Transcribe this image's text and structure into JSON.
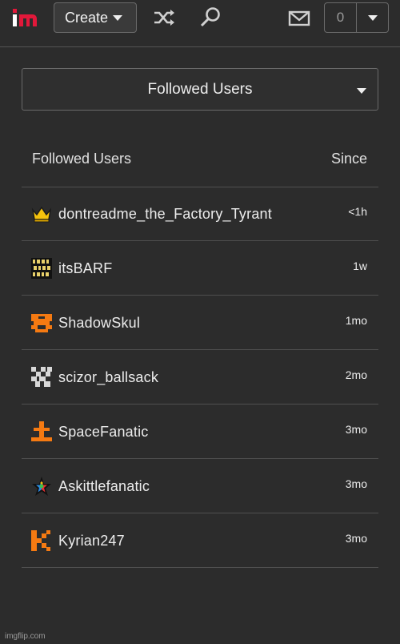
{
  "header": {
    "logo_text": "im",
    "create_label": "Create",
    "notification_count": "0"
  },
  "icons": {
    "logo": "imgflip-logo",
    "shuffle": "shuffle-icon",
    "search": "search-icon",
    "mail": "mail-icon"
  },
  "colors": {
    "background": "#2c2c2c",
    "logo_i": "#ffffff",
    "logo_m": "#e2183a",
    "avatar_orange": "#f57a12"
  },
  "filter": {
    "selected": "Followed Users"
  },
  "list": {
    "header_left": "Followed Users",
    "header_right": "Since",
    "rows": [
      {
        "name": "dontreadme_the_Factory_Tyrant",
        "since": "<1h",
        "avatar": "crown-avatar"
      },
      {
        "name": "itsBARF",
        "since": "1w",
        "avatar": "binary-avatar"
      },
      {
        "name": "ShadowSkul",
        "since": "1mo",
        "avatar": "orange-pixel-avatar"
      },
      {
        "name": "scizor_ballsack",
        "since": "2mo",
        "avatar": "grey-pixel-avatar"
      },
      {
        "name": "SpaceFanatic",
        "since": "3mo",
        "avatar": "orange-pixel-avatar"
      },
      {
        "name": "Askittlefanatic",
        "since": "3mo",
        "avatar": "rainbow-star-avatar"
      },
      {
        "name": "Kyrian247",
        "since": "3mo",
        "avatar": "orange-letter-k-avatar"
      }
    ]
  },
  "watermark": "imgflip.com"
}
